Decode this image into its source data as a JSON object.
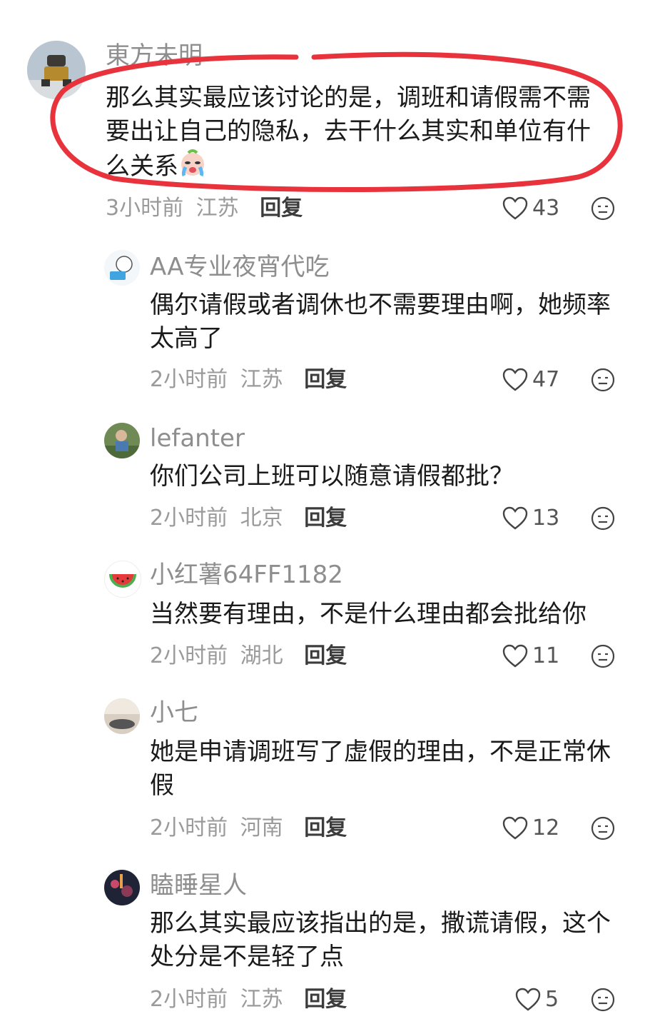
{
  "comments": [
    {
      "username": "東方未明",
      "content": "那么其实最应该讨论的是，调班和请假需不需要出让自己的隐私，去干什么其实和单位有什么关系",
      "emoji": "crying-emoji",
      "time": "3小时前",
      "location": "江苏",
      "reply": "回复",
      "likes": "43",
      "avatar": "robot-toy-avatar"
    },
    {
      "username": "AA专业夜宵代吃",
      "content": "偶尔请假或者调休也不需要理由啊，她频率太高了",
      "time": "2小时前",
      "location": "江苏",
      "reply": "回复",
      "likes": "47",
      "avatar": "cartoon-avatar"
    },
    {
      "username": "lefanter",
      "content": "你们公司上班可以随意请假都批？",
      "time": "2小时前",
      "location": "北京",
      "reply": "回复",
      "likes": "13",
      "avatar": "child-photo-avatar"
    },
    {
      "username": "小红薯64FF1182",
      "content": "当然要有理由，不是什么理由都会批给你",
      "time": "2小时前",
      "location": "湖北",
      "reply": "回复",
      "likes": "11",
      "avatar": "watermelon-avatar"
    },
    {
      "username": "小七",
      "content": "她是申请调班写了虚假的理由，不是正常休假",
      "time": "2小时前",
      "location": "河南",
      "reply": "回复",
      "likes": "12",
      "avatar": "room-photo-avatar"
    },
    {
      "username": "瞌睡星人",
      "content": "那么其实最应该指出的是，撒谎请假，这个处分是不是轻了点",
      "time": "2小时前",
      "location": "江苏",
      "reply": "回复",
      "likes": "5",
      "avatar": "night-photo-avatar"
    }
  ],
  "colors": {
    "annotation_circle": "#e8323c",
    "username": "#8e8e8e",
    "meta": "#9a9a9a"
  }
}
